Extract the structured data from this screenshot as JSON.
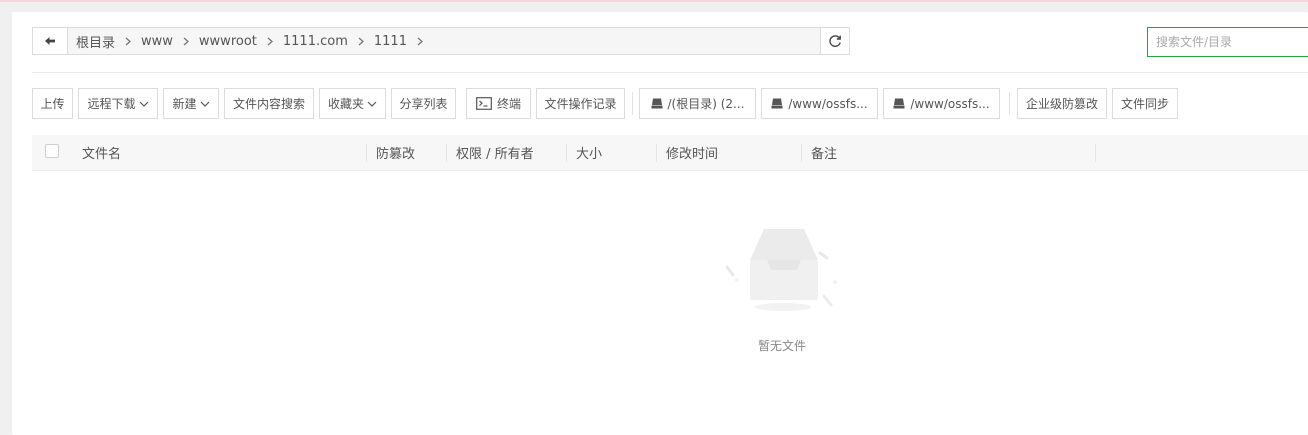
{
  "breadcrumb": {
    "items": [
      "根目录",
      "www",
      "wwwroot",
      "1111.com",
      "1111"
    ]
  },
  "search": {
    "placeholder": "搜索文件/目录"
  },
  "toolbar": {
    "upload": "上传",
    "remote_download": "远程下载",
    "new": "新建",
    "content_search": "文件内容搜索",
    "favorites": "收藏夹",
    "share_list": "分享列表",
    "terminal": "终端",
    "operation_log": "文件操作记录",
    "disk_root": "/(根目录) (2...",
    "disk_oss_1": "/www/ossfs...",
    "disk_oss_2": "/www/ossfs...",
    "tamper_proof_enterprise": "企业级防篡改",
    "file_sync": "文件同步"
  },
  "table": {
    "columns": [
      "文件名",
      "防篡改",
      "权限 / 所有者",
      "大小",
      "修改时间",
      "备注"
    ]
  },
  "empty_state": {
    "text": "暂无文件"
  },
  "colors": {
    "accent": "#20a53a",
    "border": "#dcdcdc",
    "header_bg": "#f7f7f7"
  },
  "icons": [
    "back-arrow-icon",
    "chevron-right-icon",
    "refresh-icon",
    "chevron-down-icon",
    "terminal-icon",
    "disk-icon",
    "empty-box-icon"
  ]
}
